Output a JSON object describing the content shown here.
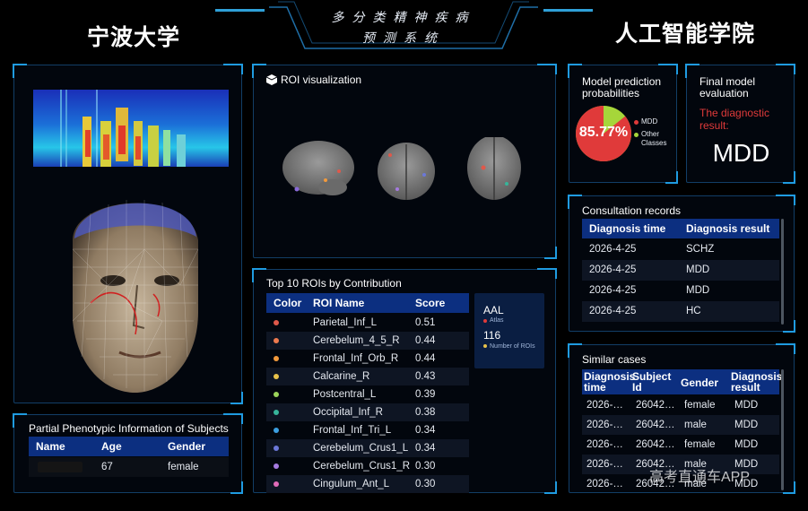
{
  "header": {
    "left_title": "宁波大学",
    "right_title": "人工智能学院",
    "center_line1": "多分类精神疾病",
    "center_line2": "预测系统"
  },
  "phenotype": {
    "title": "Partial Phenotypic Information of Subjects",
    "columns": [
      "Name",
      "Age",
      "Gender"
    ],
    "row": {
      "name": "",
      "age": "67",
      "gender": "female"
    }
  },
  "roi_viz": {
    "title": "ROI visualization",
    "icon": "cube-icon"
  },
  "top10": {
    "title": "Top 10 ROIs by Contribution",
    "columns": [
      "Color",
      "ROI Name",
      "Score"
    ],
    "rows": [
      {
        "name": "Parietal_Inf_L",
        "score": "0.51",
        "color": "#e0584a"
      },
      {
        "name": "Cerebelum_4_5_R",
        "score": "0.44",
        "color": "#ee7a4e"
      },
      {
        "name": "Frontal_Inf_Orb_R",
        "score": "0.44",
        "color": "#f29a3c"
      },
      {
        "name": "Calcarine_R",
        "score": "0.43",
        "color": "#e8c24a"
      },
      {
        "name": "Postcentral_L",
        "score": "0.39",
        "color": "#9bd35a"
      },
      {
        "name": "Occipital_Inf_R",
        "score": "0.38",
        "color": "#37b59a"
      },
      {
        "name": "Frontal_Inf_Tri_L",
        "score": "0.34",
        "color": "#3b9ee0"
      },
      {
        "name": "Cerebelum_Crus1_L",
        "score": "0.34",
        "color": "#6b78d8"
      },
      {
        "name": "Cerebelum_Crus1_R",
        "score": "0.30",
        "color": "#a67be0"
      },
      {
        "name": "Cingulum_Ant_L",
        "score": "0.30",
        "color": "#e06bb8"
      }
    ],
    "atlas_box": {
      "atlas_name": "AAL",
      "atlas_label": "Atlas",
      "count": "116",
      "count_label": "Number of ROIs"
    }
  },
  "prediction": {
    "title": "Model prediction probabilities",
    "percent": "85.77%",
    "mdd_fraction": 0.8577,
    "legend": [
      {
        "label": "MDD",
        "color": "#e03a3a"
      },
      {
        "label": "Other Classes",
        "color": "#a6d63a"
      }
    ]
  },
  "evaluation": {
    "title": "Final model evaluation",
    "label": "The diagnostic result:",
    "result": "MDD"
  },
  "consultation": {
    "title": "Consultation records",
    "columns": [
      "Diagnosis time",
      "Diagnosis result"
    ],
    "rows": [
      {
        "time": "2026-4-25",
        "result": "SCHZ"
      },
      {
        "time": "2026-4-25",
        "result": "MDD"
      },
      {
        "time": "2026-4-25",
        "result": "MDD"
      },
      {
        "time": "2026-4-25",
        "result": "HC"
      }
    ]
  },
  "similar": {
    "title": "Similar cases",
    "columns": [
      "Diagnosis time",
      "Subject Id",
      "Gender",
      "Diagnosis result"
    ],
    "rows": [
      {
        "time": "2026-…",
        "id": "26042…",
        "gender": "female",
        "result": "MDD"
      },
      {
        "time": "2026-…",
        "id": "26042…",
        "gender": "male",
        "result": "MDD"
      },
      {
        "time": "2026-…",
        "id": "26042…",
        "gender": "female",
        "result": "MDD"
      },
      {
        "time": "2026-…",
        "id": "26042…",
        "gender": "male",
        "result": "MDD"
      },
      {
        "time": "2026-…",
        "id": "26042…",
        "gender": "male",
        "result": "MDD"
      }
    ]
  },
  "watermark": "高考直通车APP"
}
